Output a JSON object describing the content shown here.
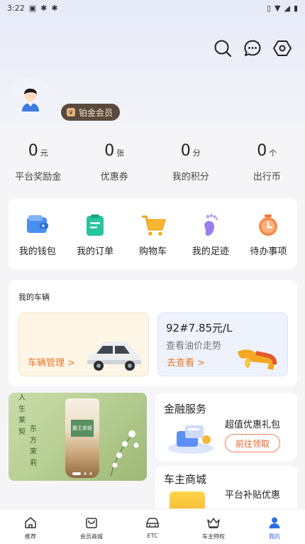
{
  "status_bar": {
    "time": "3:22"
  },
  "profile": {
    "member_level": "铂金会员"
  },
  "stats": [
    {
      "value": "0",
      "unit": "元",
      "label": "平台奖励金"
    },
    {
      "value": "0",
      "unit": "张",
      "label": "优惠券"
    },
    {
      "value": "0",
      "unit": "分",
      "label": "我的积分"
    },
    {
      "value": "0",
      "unit": "个",
      "label": "出行币"
    }
  ],
  "quick_actions": [
    {
      "label": "我的钱包",
      "icon": "wallet-icon"
    },
    {
      "label": "我的订单",
      "icon": "order-icon"
    },
    {
      "label": "购物车",
      "icon": "cart-icon"
    },
    {
      "label": "我的足迹",
      "icon": "footprint-icon"
    },
    {
      "label": "待办事项",
      "icon": "todo-clock-icon"
    }
  ],
  "vehicles": {
    "title": "我的车辆",
    "manage_link": "车辆管理 >",
    "oil_price": "92#7.85元/L",
    "oil_trend_text": "查看油价走势",
    "oil_link": "去查看 >"
  },
  "promo": {
    "col1": [
      "人",
      "生",
      "茉",
      "契"
    ],
    "col2": [
      "东",
      "方",
      "茉",
      "莉"
    ],
    "cup_label": "霸王茶姬"
  },
  "finance": {
    "title": "金融服务",
    "desc": "超值优惠礼包",
    "button": "前往领取"
  },
  "mall": {
    "title": "车主商城",
    "desc": "平台补贴优惠"
  },
  "tabs": [
    {
      "label": "推荐",
      "icon": "home-icon"
    },
    {
      "label": "会员商城",
      "icon": "mall-icon"
    },
    {
      "label": "ETC",
      "icon": "car-icon"
    },
    {
      "label": "车主特权",
      "icon": "crown-icon"
    },
    {
      "label": "我的",
      "icon": "person-icon"
    }
  ],
  "colors": {
    "accent": "#2b6fe6",
    "orange": "#e8782a",
    "badge_bg": "#5a4a3e"
  }
}
